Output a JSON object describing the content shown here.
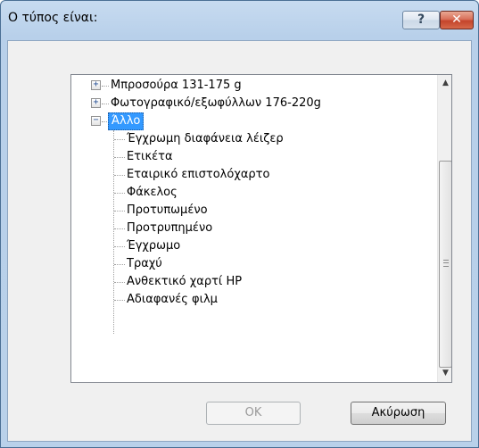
{
  "window": {
    "title": "Ο τύπος είναι:",
    "help_label": "?",
    "close_label": "✕"
  },
  "tree": {
    "items": [
      {
        "label": "Μπροσούρα 131-175 g",
        "expander": "+"
      },
      {
        "label": "Φωτογραφικό/εξωφύλλων 176-220g",
        "expander": "+"
      },
      {
        "label": "Άλλο",
        "expander": "−",
        "selected": true
      }
    ],
    "children": [
      "Έγχρωμη διαφάνεια λέιζερ",
      "Ετικέτα",
      "Εταιρικό επιστολόχαρτο",
      "Φάκελος",
      "Προτυπωμένο",
      "Προτρυπημένο",
      "Έγχρωμο",
      "Τραχύ",
      "Ανθεκτικό χαρτί HP",
      "Αδιαφανές φιλμ"
    ]
  },
  "scrollbar": {
    "up_icon": "▲",
    "down_icon": "▼"
  },
  "buttons": {
    "ok_label": "OK",
    "cancel_label": "Ακύρωση"
  },
  "colors": {
    "selection": "#3399ff",
    "title_bar": "#b9d1ea",
    "close_button": "#c4442b"
  }
}
